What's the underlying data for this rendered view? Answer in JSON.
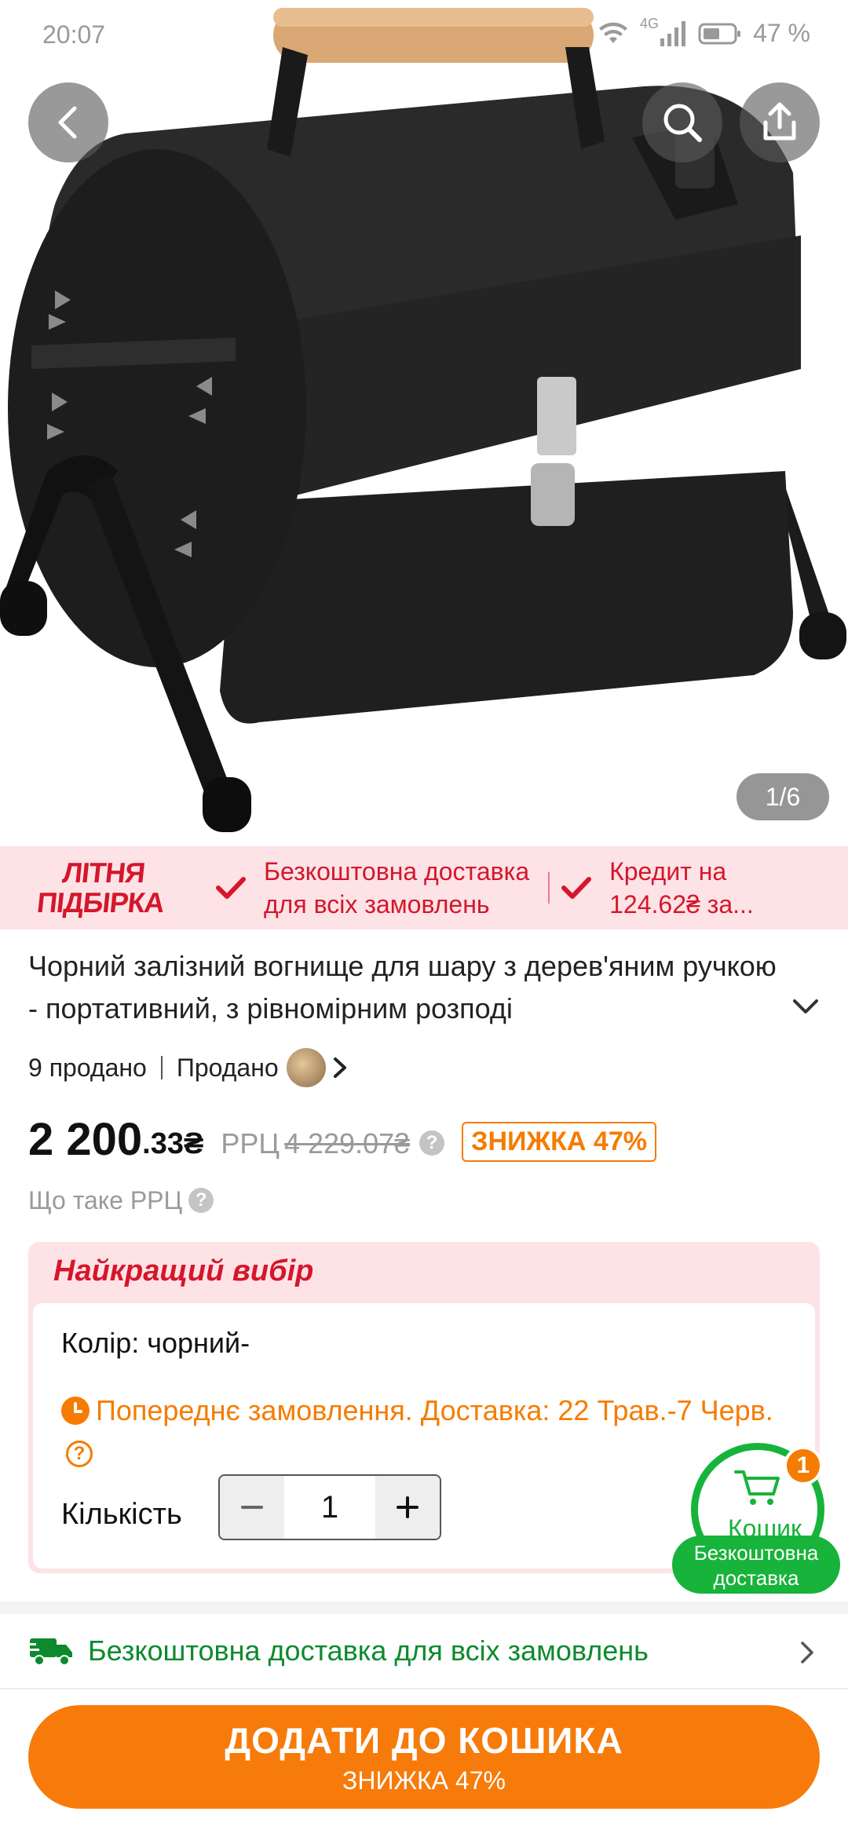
{
  "status_bar": {
    "time": "20:07",
    "network": "4G",
    "battery": "47 %"
  },
  "gallery": {
    "counter": "1/6"
  },
  "promo": {
    "logo_line1": "ЛІТНЯ",
    "logo_line2": "ПІДБІРКА",
    "item1_line1": "Безкоштовна доставка",
    "item1_line2": "для всіх замовлень",
    "item2_line1": "Кредит на",
    "item2_line2": "124.62₴ за..."
  },
  "product": {
    "title": "Чорний залізний вогнище для шару з дерев'яним ручкою - портативний, з рівномірним розподі",
    "sold": "9 продано",
    "seller_label": "Продано",
    "price_main": "2 200",
    "price_cents": ".33₴",
    "rrp_label": "РРЦ",
    "rrp_price": "4 229.07₴",
    "discount": "ЗНИЖКА 47%",
    "rrp_question": "Що таке РРЦ"
  },
  "best_choice": {
    "title": "Найкращий вибір",
    "color_label": "Колір: чорний-",
    "preorder": "Попереднє замовлення. Доставка: 22 Трав.-7 Черв.",
    "qty_label": "Кількість",
    "qty_value": "1"
  },
  "cart": {
    "label": "Кошик",
    "badge": "1",
    "pill_line1": "Безкоштовна",
    "pill_line2": "доставка"
  },
  "shipping": {
    "text": "Безкоштовна доставка для всіх замовлень"
  },
  "add_to_cart": {
    "label": "ДОДАТИ ДО КОШИКА",
    "sub": "ЗНИЖКА 47%"
  },
  "colors": {
    "accent_orange": "#f77b0a",
    "promo_red": "#d5162b",
    "green": "#18b33a"
  }
}
